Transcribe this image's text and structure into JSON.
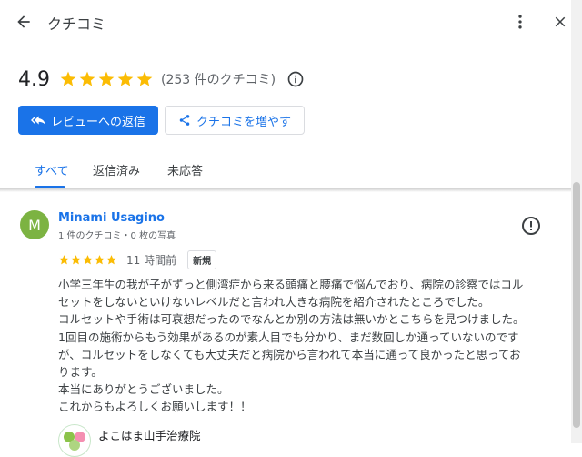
{
  "header": {
    "title": "クチコミ",
    "back_icon": "arrow-back-icon",
    "more_icon": "more-vert-icon",
    "close_icon": "close-icon"
  },
  "summary": {
    "rating": "4.9",
    "stars": 5,
    "count_text": "(253 件のクチコミ)"
  },
  "actions": {
    "reply_label": "レビューへの返信",
    "get_more_label": "クチコミを増やす"
  },
  "tabs": [
    {
      "label": "すべて",
      "active": true
    },
    {
      "label": "返信済み",
      "active": false
    },
    {
      "label": "未応答",
      "active": false
    }
  ],
  "review": {
    "avatar_letter": "M",
    "name": "Minami Usagino",
    "meta": "1 件のクチコミ・0 枚の写真",
    "stars": 5,
    "time": "11 時間前",
    "badge": "新規",
    "lines": [
      "小学三年生の我が子がずっと側湾症から来る頭痛と腰痛で悩んでおり、病院の診察ではコル",
      "セットをしないといけないレベルだと言われ大きな病院を紹介されたところでした。",
      "コルセットや手術は可哀想だったのでなんとか別の方法は無いかとこちらを見つけました。",
      "1回目の施術からもう効果があるのが素人目でも分かり、まだ数回しか通っていないのです",
      "が、コルセットをしなくても大丈夫だと病院から言われて本当に通って良かったと思ってお",
      "ります。",
      "本当にありがとうございました。",
      "これからもよろしくお願いします！！"
    ]
  },
  "owner": {
    "name": "よこはま山手治療院"
  },
  "colors": {
    "accent": "#1a73e8",
    "star": "#fbbc04",
    "avatar": "#7cb342"
  }
}
